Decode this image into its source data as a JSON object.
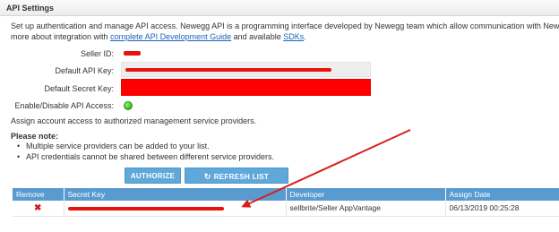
{
  "panel": {
    "title": "API Settings"
  },
  "description": {
    "line1": "Set up authentication and manage API access. Newegg API is a programming interface developed by Newegg team which allow communication with Newegg Marketplace",
    "line2_prefix": "more about integration with ",
    "guide_link": "complete API Development Guide",
    "line2_middle": " and available ",
    "sdk_link": "SDKs",
    "line2_suffix": "."
  },
  "fields": {
    "seller_id_label": "Seller ID:",
    "api_key_label": "Default API Key:",
    "secret_key_label": "Default Secret Key:",
    "api_access_label": "Enable/Disable API Access:",
    "api_access_enabled": true
  },
  "assign_note": "Assign account access to authorized management service providers.",
  "please_note": {
    "title": "Please note:",
    "items": [
      "Multiple service providers can be added to your list.",
      "API credentials cannot be shared between different service providers."
    ]
  },
  "buttons": {
    "authorize": "AUTHORIZE",
    "refresh": "REFRESH LIST",
    "refresh_icon": "refresh-icon"
  },
  "table": {
    "headers": [
      "Remove",
      "Secret Key",
      "Developer",
      "Assign Date"
    ],
    "rows": [
      {
        "remove_icon": "remove-x-icon",
        "developer": "sellbrite/Seller AppVantage",
        "assign_date": "06/13/2019 00:25:28"
      }
    ]
  },
  "colors": {
    "header_blue": "#5a9bcf",
    "button_blue": "#5fa8d9",
    "link_blue": "#1a63b5",
    "redaction_red": "#e8120d",
    "annotation_arrow": "#d6201a",
    "status_green": "#34b51b"
  }
}
